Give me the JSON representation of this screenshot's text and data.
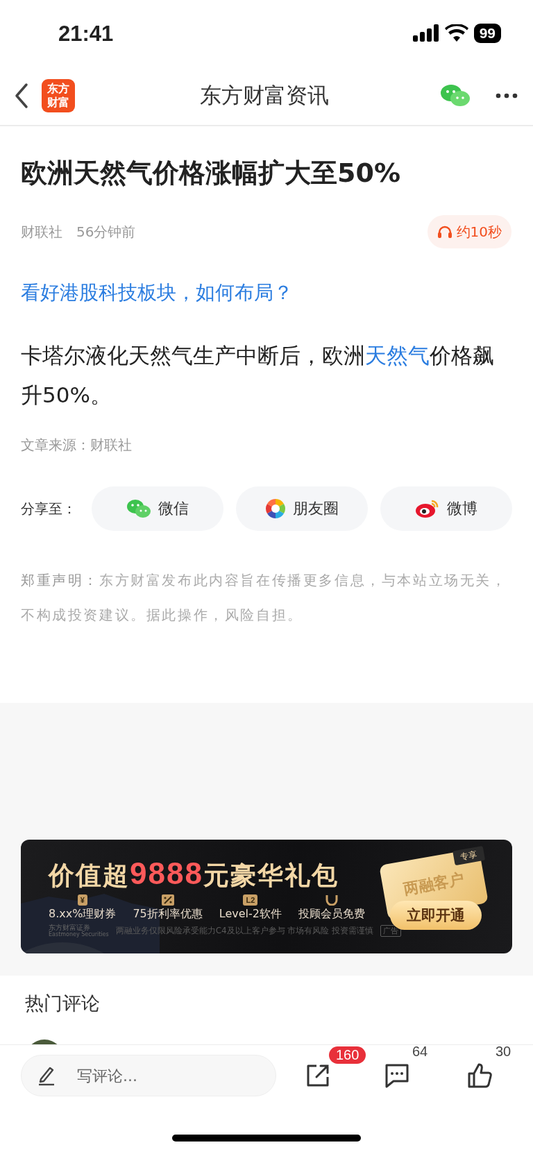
{
  "status_bar": {
    "time": "21:41",
    "battery": "99"
  },
  "nav": {
    "logo": [
      "东方",
      "财富"
    ],
    "title": "东方财富资讯"
  },
  "article": {
    "title": "欧洲天然气价格涨幅扩大至50%",
    "source": "财联社",
    "time": "56分钟前",
    "audio": "约10秒",
    "promo_link": "看好港股科技板块，如何布局？",
    "body": [
      {
        "kind": "plain",
        "text": "卡塔尔液化天然气生产中断后，欧洲"
      },
      {
        "kind": "link",
        "text": "天然气"
      },
      {
        "kind": "plain",
        "text": "价格飙升50%。"
      }
    ],
    "source_note": "文章来源：财联社",
    "share_label": "分享至：",
    "share": [
      {
        "kind": "wechat",
        "label": "微信"
      },
      {
        "kind": "moments",
        "label": "朋友圈"
      },
      {
        "kind": "weibo",
        "label": "微博"
      }
    ],
    "disclaimer_label": "郑重声明：",
    "disclaimer": "东方财富发布此内容旨在传播更多信息，与本站立场无关，不构成投资建议。据此操作，风险自担。"
  },
  "ad": {
    "headline_pre": "价值超",
    "headline_amount": "9888",
    "headline_post": "元豪华礼包",
    "perks": [
      {
        "kind": "yen",
        "badge": "¥",
        "label": "8.xx%理财券"
      },
      {
        "kind": "percent",
        "label": "75折利率优惠"
      },
      {
        "kind": "l2",
        "badge": "L2",
        "label": "Level-2软件"
      },
      {
        "kind": "u",
        "label": "投顾会员免费"
      }
    ],
    "card_tag": "专享",
    "card_label": "两融客户",
    "cta": "立即开通",
    "brand": "东方财富证券",
    "brand_en": "Eastmoney Securities",
    "notice": "两融业务仅限风险承受能力C4及以上客户参与 市场有风险 投资需谨慎",
    "ad_tag": "广告"
  },
  "comments": {
    "heading": "热门评论"
  },
  "bottom_bar": {
    "placeholder": "写评论...",
    "share_count": "160",
    "comment_count": "64",
    "like_count": "30"
  }
}
